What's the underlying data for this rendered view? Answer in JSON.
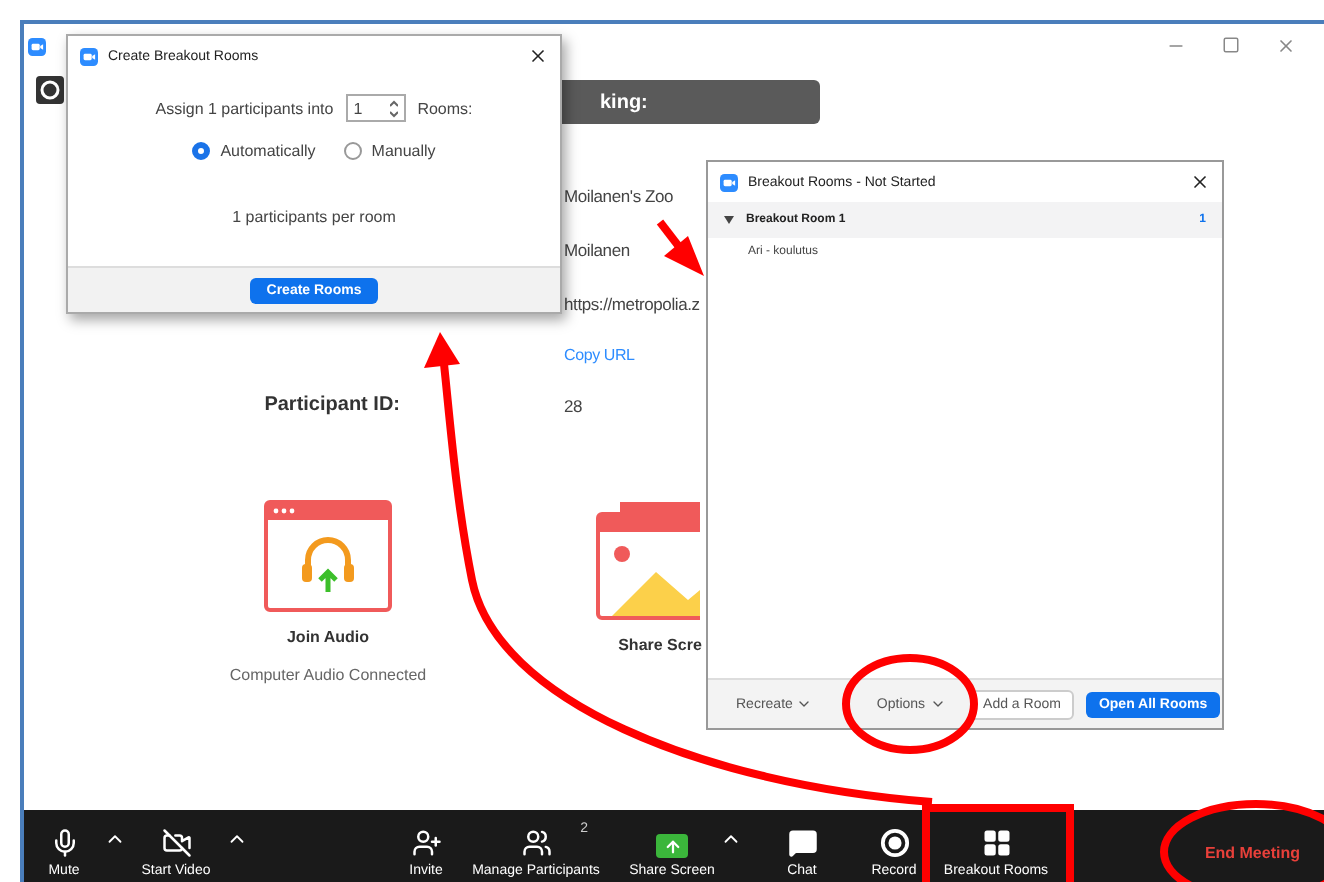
{
  "talking_bar": {
    "text": "king:"
  },
  "meeting_info": [
    {
      "kind": "text",
      "value": "Moilanen's Zoo"
    },
    {
      "kind": "text",
      "value": "Moilanen"
    },
    {
      "kind": "text",
      "value": "https://metropolia.z"
    },
    {
      "kind": "link",
      "value": "Copy URL"
    },
    {
      "kind": "text",
      "label": "Participant ID:",
      "value": "28"
    }
  ],
  "actions": [
    {
      "kind": "audio",
      "label": "Join Audio",
      "sublabel": "Computer Audio Connected"
    },
    {
      "kind": "share",
      "label": "Share Scre"
    }
  ],
  "toolbar": [
    {
      "kind": "mic",
      "label": "Mute"
    },
    {
      "kind": "caret"
    },
    {
      "kind": "video",
      "label": "Start Video"
    },
    {
      "kind": "caret"
    },
    {
      "kind": "invite",
      "label": "Invite"
    },
    {
      "kind": "participants",
      "label": "Manage Participants",
      "badge": "2"
    },
    {
      "kind": "share",
      "label": "Share Screen"
    },
    {
      "kind": "caret"
    },
    {
      "kind": "chat",
      "label": "Chat"
    },
    {
      "kind": "record",
      "label": "Record"
    },
    {
      "kind": "breakout",
      "label": "Breakout Rooms"
    },
    {
      "kind": "end",
      "label": "End Meeting"
    }
  ],
  "create_dialog": {
    "title": "Create Breakout Rooms",
    "assign_prefix": "Assign 1 participants into",
    "rooms_value": "1",
    "rooms_suffix": "Rooms:",
    "options": [
      {
        "label": "Automatically",
        "selected": true
      },
      {
        "label": "Manually",
        "selected": false
      }
    ],
    "summary": "1 participants per room",
    "button": "Create Rooms"
  },
  "rooms_panel": {
    "title": "Breakout Rooms - Not Started",
    "rooms": [
      {
        "name": "Breakout Room 1",
        "count": "1",
        "expanded": true,
        "participants": [
          "Ari - koulutus"
        ]
      }
    ],
    "buttons": [
      {
        "kind": "menu",
        "label": "Recreate"
      },
      {
        "kind": "menu",
        "label": "Options"
      },
      {
        "kind": "outline",
        "label": "Add a Room"
      },
      {
        "kind": "primary",
        "label": "Open All Rooms"
      }
    ]
  }
}
